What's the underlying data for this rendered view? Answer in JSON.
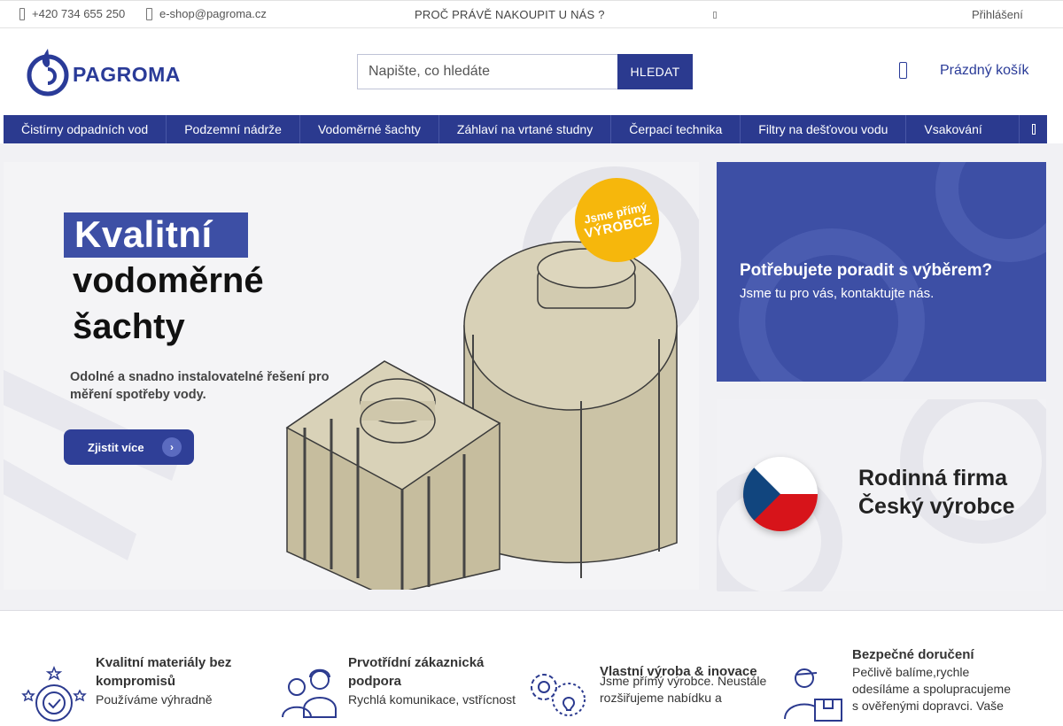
{
  "topbar": {
    "phone": "+420 734 655 250",
    "email": "e-shop@pagroma.cz",
    "why_link": "PROČ PRÁVĚ NAKOUPIT U NÁS ?",
    "login": "Přihlášení"
  },
  "header": {
    "logo_text": "PAGROMA",
    "search_placeholder": "Napište, co hledáte",
    "search_button": "HLEDAT",
    "cart_label": "Prázdný košík"
  },
  "nav": {
    "items": [
      "Čistírny odpadních vod",
      "Podzemní nádrže",
      "Vodoměrné šachty",
      "Záhlaví na vrtané studny",
      "Čerpací technika",
      "Filtry na dešťovou vodu",
      "Vsakování"
    ]
  },
  "main_banner": {
    "title_line1": "Kvalitní",
    "title_line2": "vodoměrné",
    "title_line3": "šachty",
    "description": "Odolné a snadno instalovatelné řešení pro měření spotřeby vody.",
    "button_label": "Zjistit více",
    "badge_line1": "Jsme přímý",
    "badge_line2": "VÝROBCE"
  },
  "side_banner_top": {
    "heading": "Potřebujete poradit s výběrem?",
    "text": "Jsme tu pro vás, kontaktujte nás."
  },
  "side_banner_bottom": {
    "line1": "Rodinná firma",
    "line2": "Český výrobce"
  },
  "features": [
    {
      "title": "Kvalitní materiály bez kompromisů",
      "text": "Používáme výhradně",
      "icon": "quality-badge-icon"
    },
    {
      "title": "Prvotřídní zákaznická podpora",
      "text": "Rychlá komunikace, vstřícnost",
      "icon": "customer-support-icon"
    },
    {
      "title": "Vlastní výroba & inovace",
      "text": "Jsme přímý výrobce. Neustále rozšiřujeme nabídku a",
      "icon": "production-gears-icon"
    },
    {
      "title": "Bezpečné doručení",
      "text": "Pečlivě balíme,rychle odesíláme a spolupracujeme s ověřenými dopravci. Vaše",
      "icon": "delivery-courier-icon"
    }
  ],
  "colors": {
    "brand_blue": "#2b3a8f",
    "banner_blue": "#3d4fa5",
    "badge_yellow": "#f6b70c"
  }
}
